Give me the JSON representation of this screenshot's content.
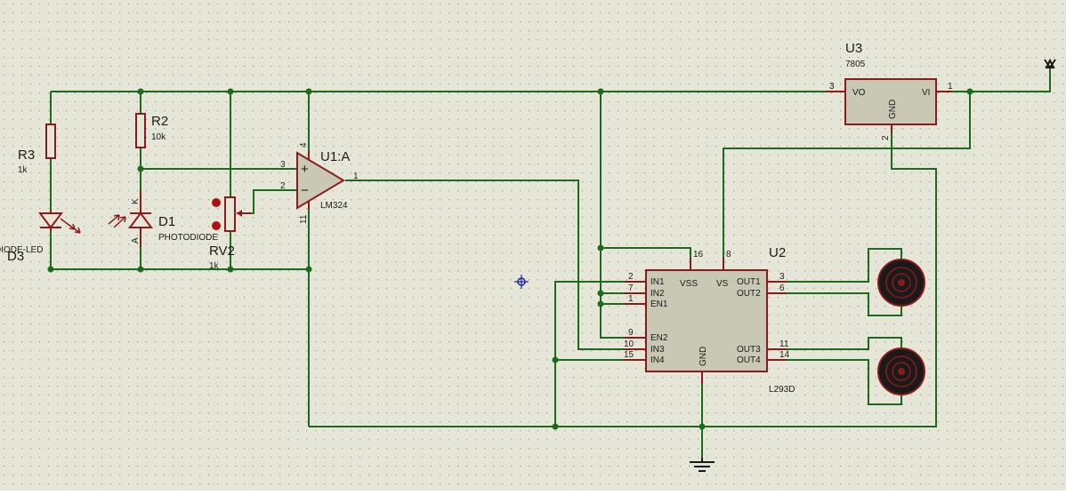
{
  "colors": {
    "background": "#e6e6d8",
    "grid_dot": "#9c9c90",
    "wire": "#1c6b1c",
    "component_outline": "#8b1a1a",
    "ic_fill": "#c8c8b4",
    "text": "#1a1a1a",
    "cursor": "#1a2aa0"
  },
  "components": {
    "u3": {
      "ref": "U3",
      "value": "7805",
      "pin_vo": "VO",
      "pin_vi": "VI",
      "pin_gnd": "GND",
      "pin_num_vo": "3",
      "pin_num_vi": "1",
      "pin_num_gnd": "2"
    },
    "r2": {
      "ref": "R2",
      "value": "10k"
    },
    "r3": {
      "ref": "R3",
      "value": "1k"
    },
    "d1": {
      "ref": "D1",
      "value": "PHOTODIODE",
      "pin_k": "K",
      "pin_a": "A"
    },
    "d3": {
      "ref": "D3",
      "value": "DIODE-LED"
    },
    "rv2": {
      "ref": "RV2",
      "value": "1k"
    },
    "u1": {
      "ref": "U1:A",
      "value": "LM324",
      "plus": "+",
      "minus": "−",
      "pin_in_plus": "3",
      "pin_in_minus": "2",
      "pin_out": "1",
      "pin_vcc": "4",
      "pin_gnd": "11"
    },
    "u2": {
      "ref": "U2",
      "value": "L293D",
      "left_pins": [
        {
          "num": "2",
          "name": "IN1"
        },
        {
          "num": "7",
          "name": "IN2"
        },
        {
          "num": "1",
          "name": "EN1"
        },
        {
          "num": "9",
          "name": "EN2"
        },
        {
          "num": "10",
          "name": "IN3"
        },
        {
          "num": "15",
          "name": "IN4"
        }
      ],
      "right_pins": [
        {
          "num": "3",
          "name": "OUT1"
        },
        {
          "num": "6",
          "name": "OUT2"
        },
        {
          "num": "11",
          "name": "OUT3"
        },
        {
          "num": "14",
          "name": "OUT4"
        }
      ],
      "top_pins": [
        {
          "num": "16",
          "name": "VSS"
        },
        {
          "num": "8",
          "name": "VS"
        }
      ],
      "bottom_pin": {
        "name": "GND"
      }
    }
  },
  "icons": [
    "power-terminal-icon",
    "ground-icon",
    "motor-icon",
    "cursor-crosshair-icon"
  ]
}
